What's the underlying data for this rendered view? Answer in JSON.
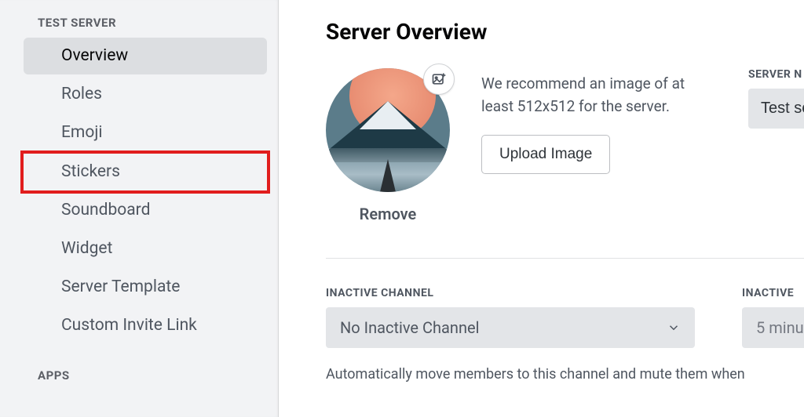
{
  "sidebar": {
    "header": "TEST SERVER",
    "items": [
      {
        "label": "Overview",
        "selected": true
      },
      {
        "label": "Roles"
      },
      {
        "label": "Emoji"
      },
      {
        "label": "Stickers",
        "highlight": true
      },
      {
        "label": "Soundboard"
      },
      {
        "label": "Widget"
      },
      {
        "label": "Server Template"
      },
      {
        "label": "Custom Invite Link"
      }
    ],
    "section2": "APPS"
  },
  "main": {
    "title": "Server Overview",
    "image_hint": "We recommend an image of at least 512x512 for the server.",
    "upload_button": "Upload Image",
    "remove_link": "Remove",
    "server_name_label": "SERVER N",
    "server_name_value": "Test se",
    "inactive_channel_label": "INACTIVE CHANNEL",
    "inactive_channel_value": "No Inactive Channel",
    "inactive_timeout_label": "INACTIVE",
    "inactive_timeout_value": "5 minu",
    "inactive_help": "Automatically move members to this channel and mute them when"
  }
}
